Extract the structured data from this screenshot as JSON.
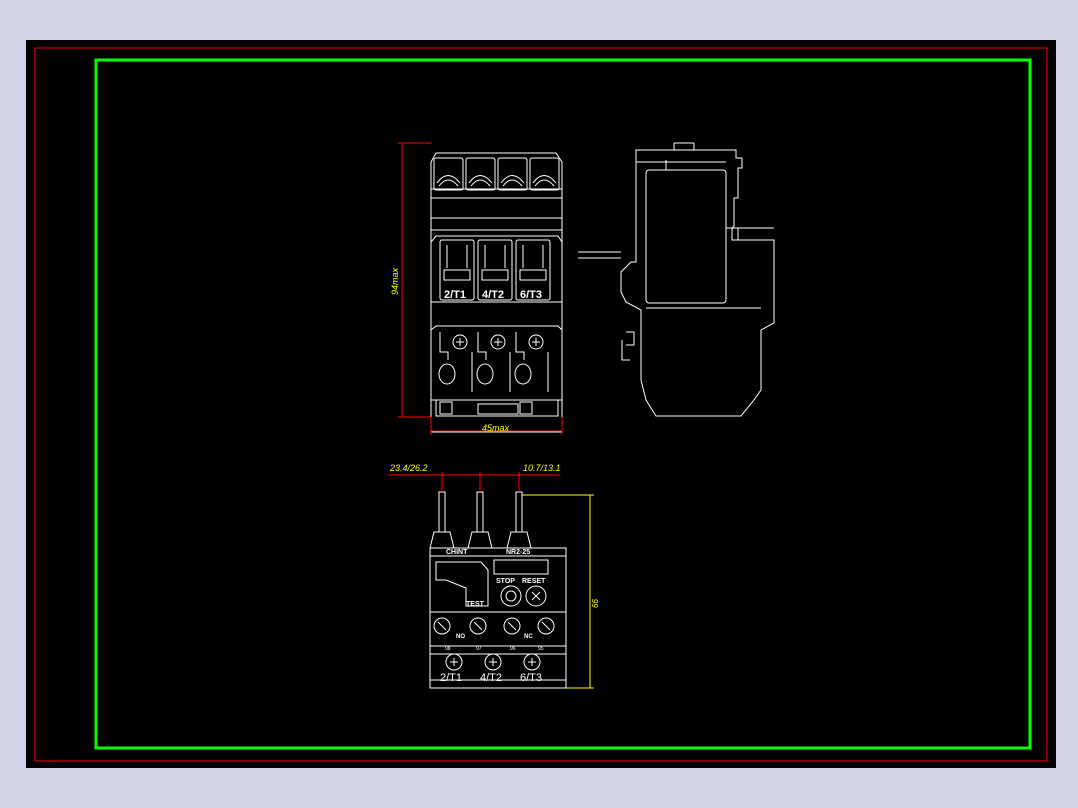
{
  "colors": {
    "background_outer": "#d3d3e8",
    "paper": "#000000",
    "frame_outer": "#ff0000",
    "frame_inner": "#00ff00",
    "geometry": "#ffffff",
    "dimensions": "#ff0000",
    "dimension_text": "#ffff00"
  },
  "top_view": {
    "terminal_labels": [
      "2/T1",
      "4/T2",
      "6/T3"
    ],
    "height_dim": "94max",
    "width_dim": "45max"
  },
  "front_view": {
    "pitch_dim_left": "23.4/26.2",
    "pitch_dim_right": "10.7/13.1",
    "height_dim": "66",
    "brand_text": "CHINT",
    "model_text": "NR2-25",
    "button_labels": [
      "STOP",
      "RESET"
    ],
    "test_label": "TEST",
    "contact_labels": [
      "NO",
      "NC"
    ],
    "aux_numbers": [
      "98",
      "97",
      "96",
      "95"
    ],
    "terminal_labels": [
      "2/T1",
      "4/T2",
      "6/T3"
    ]
  }
}
